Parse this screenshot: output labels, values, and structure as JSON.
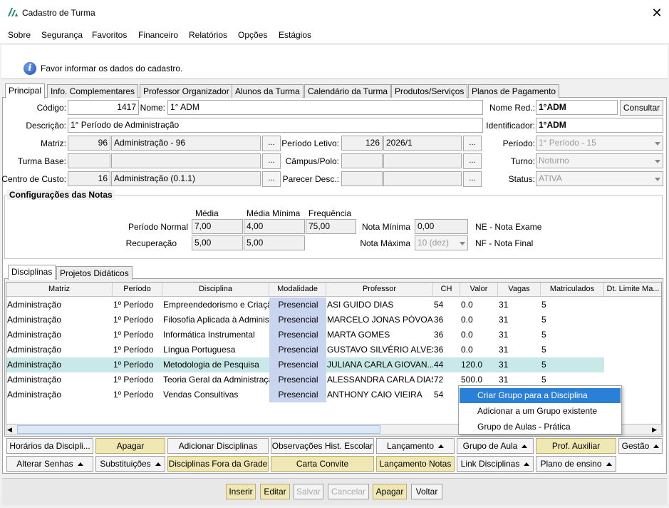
{
  "window": {
    "title": "Cadastro de Turma"
  },
  "menu": [
    "Sobre",
    "Segurança",
    "Favoritos",
    "Financeiro",
    "Relatórios",
    "Opções",
    "Estágios"
  ],
  "info": {
    "message": "Favor informar os dados do cadastro."
  },
  "tabs": [
    "Principal",
    "Info. Complementares",
    "Professor Organizador",
    "Alunos da Turma",
    "Calendário da Turma",
    "Produtos/Serviços",
    "Planos de Pagamento"
  ],
  "form": {
    "codigo_label": "Código:",
    "codigo": "1417",
    "nome_label": "Nome:",
    "nome": "1° ADM",
    "nome_red_label": "Nome Red.:",
    "nome_red": "1°ADM",
    "consultar": "Consultar",
    "descricao_label": "Descrição:",
    "descricao": "1° Período de Administração",
    "identificador_label": "Identificador:",
    "identificador": "1°ADM",
    "matriz_label": "Matriz:",
    "matriz_code": "96",
    "matriz_name": "Administração - 96",
    "periodo_letivo_label": "Período Letivo:",
    "periodo_letivo_code": "126",
    "periodo_letivo_name": "2026/1",
    "periodo_label": "Período:",
    "periodo": "1° Período - 15",
    "turma_base_label": "Turma Base:",
    "turma_base_code": "",
    "turma_base_name": "",
    "campus_label": "Câmpus/Polo:",
    "campus_code": "",
    "campus_name": "",
    "turno_label": "Turno:",
    "turno": "Noturno",
    "centro_custo_label": "Centro de Custo:",
    "centro_custo_code": "16",
    "centro_custo_name": "Administração (0.1.1)",
    "parecer_label": "Parecer Desc.:",
    "parecer_code": "",
    "parecer_name": "",
    "status_label": "Status:",
    "status": "ATIVA",
    "dots": "..."
  },
  "notas": {
    "title": "Configurações das Notas",
    "col_media": "Média",
    "col_media_min": "Média Mínima",
    "col_frequencia": "Frequência",
    "periodo_normal_label": "Período Normal",
    "pn_media": "7,00",
    "pn_media_min": "4,00",
    "pn_frequencia": "75,00",
    "recuperacao_label": "Recuperação",
    "rec_media": "5,00",
    "rec_media_min": "5,00",
    "nota_minima_label": "Nota Mínima",
    "nota_minima": "0,00",
    "nota_maxima_label": "Nota Máxima",
    "nota_maxima": "10 (dez)",
    "ne_legend": "NE - Nota Exame",
    "nf_legend": "NF - Nota Final"
  },
  "subtabs": [
    "Disciplinas",
    "Projetos Didáticos"
  ],
  "grid": {
    "headers": [
      "Matriz",
      "Período",
      "Disciplina",
      "Modalidade",
      "Professor",
      "CH",
      "Valor",
      "Vagas",
      "Matriculados",
      "Dt. Limite Ma..."
    ],
    "rows": [
      [
        "Administração",
        "1º Período",
        "Empreendedorismo e Criação",
        "Presencial",
        "ASI GUIDO DIAS",
        "54",
        "0.0",
        "31",
        "5",
        ""
      ],
      [
        "Administração",
        "1º Período",
        "Filosofia Aplicada à Administração",
        "Presencial",
        "MARCELO JONAS PÓVOAS",
        "36",
        "0.0",
        "31",
        "5",
        ""
      ],
      [
        "Administração",
        "1º Período",
        "Informática Instrumental",
        "Presencial",
        "MARTA GOMES",
        "36",
        "0.0",
        "31",
        "5",
        ""
      ],
      [
        "Administração",
        "1º Período",
        "Língua Portuguesa",
        "Presencial",
        "GUSTAVO SILVÉRIO ALVES",
        "36",
        "0.0",
        "31",
        "5",
        ""
      ],
      [
        "Administração",
        "1º Período",
        "Metodologia de Pesquisa",
        "Presencial",
        "JULIANA CARLA GIOVAN...",
        "44",
        "120.0",
        "31",
        "5",
        ""
      ],
      [
        "Administração",
        "1º Período",
        "Teoria Geral da Administração",
        "Presencial",
        "ALESSANDRA CARLA DIAS",
        "72",
        "500.0",
        "31",
        "5",
        ""
      ],
      [
        "Administração",
        "1º Período",
        "Vendas Consultivas",
        "Presencial",
        "ANTHONY CAIO VIEIRA",
        "54",
        "",
        "",
        "",
        ""
      ]
    ]
  },
  "context_menu": [
    "Criar Grupo para a Disciplina",
    "Adicionar a um Grupo existente",
    "Grupo de Aulas - Prática"
  ],
  "buttons_row1": [
    "Horários da Discipli...",
    "Apagar",
    "Adicionar Disciplinas",
    "Observações Hist. Escolar",
    "Lançamento",
    "Grupo de Aula",
    "Prof. Auxiliar",
    "Gestão"
  ],
  "buttons_row2": [
    "Alterar Senhas",
    "Substituições",
    "Disciplinas Fora da Grade",
    "Carta Convite",
    "Lançamento Notas",
    "Link Disciplinas",
    "Plano de ensino"
  ],
  "footer_buttons": [
    "Inserir",
    "Editar",
    "Salvar",
    "Cancelar",
    "Apagar",
    "Voltar"
  ],
  "colors": {
    "accent": "#2a80d6",
    "yellow_button": "#f0e8b4",
    "modalidade_cell": "#c9d4ee",
    "selected_row": "#c9e8e8"
  }
}
